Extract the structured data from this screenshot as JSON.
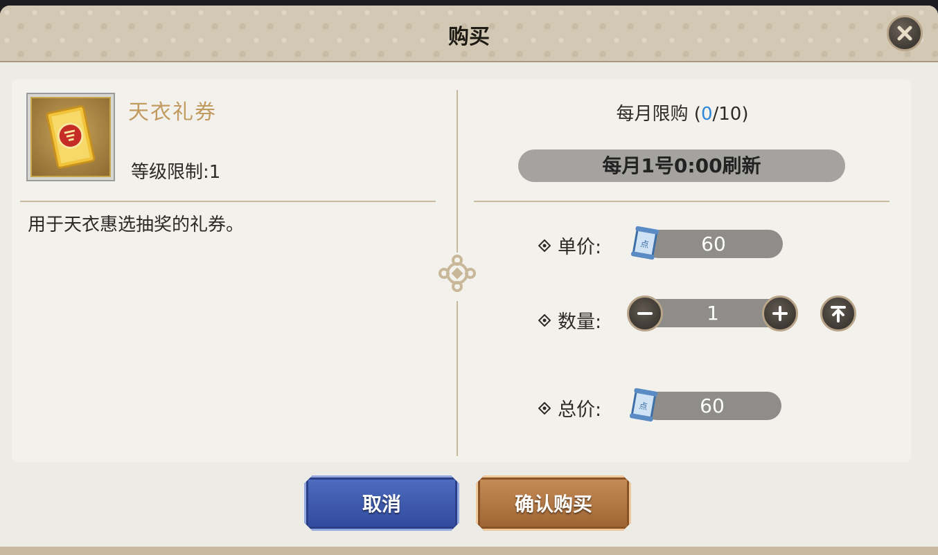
{
  "dialog": {
    "title": "购买",
    "close_icon": "close-icon"
  },
  "item": {
    "icon": "gift-coupon-icon",
    "name": "天衣礼券",
    "level_limit": "等级限制:1",
    "description": "用于天衣惠选抽奖的礼券。"
  },
  "limit": {
    "prefix": "每月限购 (",
    "current": "0",
    "sep_total": "/10)",
    "refresh": "每月1号0:00刷新"
  },
  "purchase": {
    "unit_price_label": "单价:",
    "unit_price": "60",
    "quantity_label": "数量:",
    "quantity": "1",
    "total_label": "总价:",
    "total_price": "60",
    "currency_icon": "coupon-scroll-icon"
  },
  "buttons": {
    "cancel": "取消",
    "confirm": "确认购买"
  },
  "colors": {
    "accent_gold": "#c09a5e",
    "limit_current": "#2d86d6",
    "cancel_blue": "#30489a",
    "confirm_bronze": "#9b6130"
  }
}
